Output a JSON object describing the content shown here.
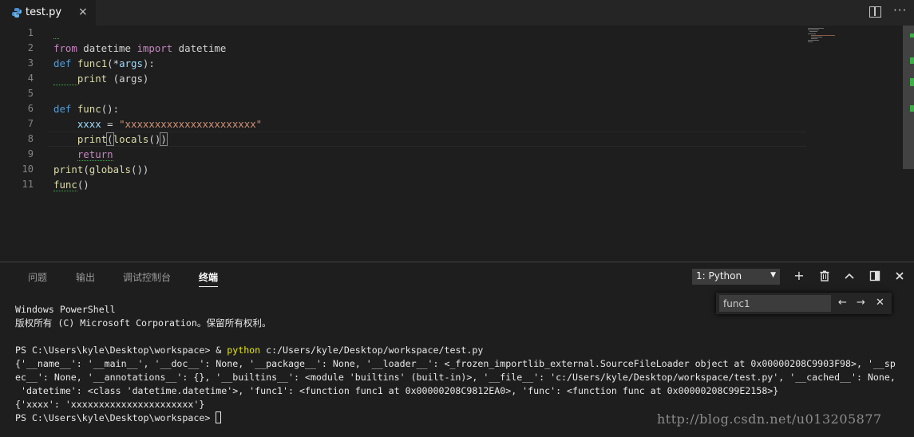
{
  "tab": {
    "filename": "test.py",
    "close": "×"
  },
  "editor_actions": {
    "more": "···"
  },
  "line_numbers": [
    "1",
    "2",
    "3",
    "4",
    "5",
    "6",
    "7",
    "8",
    "9",
    "10",
    "11"
  ],
  "code": {
    "l2": {
      "kw1": "from",
      "mod": " datetime ",
      "kw2": "import",
      "name": " datetime"
    },
    "l3": {
      "kw": "def",
      "fn": " func1",
      "open": "(*",
      "arg": "args",
      "close": "):"
    },
    "l4": {
      "fn": "print",
      "rest": " (args)"
    },
    "l6": {
      "kw": "def",
      "fn": " func",
      "rest": "():"
    },
    "l7": {
      "var": "xxxx",
      "eq": " = ",
      "str": "\"xxxxxxxxxxxxxxxxxxxxxx\""
    },
    "l8": {
      "fn": "print",
      "p1": "(",
      "fn2": "locals",
      "p2": "()",
      "p3": ")"
    },
    "l9": {
      "kw": "return"
    },
    "l10": {
      "fn": "print",
      "p1": "(",
      "fn2": "globals",
      "p2": "())"
    },
    "l11": {
      "fn": "func",
      "p": "()"
    }
  },
  "panel": {
    "tabs": [
      "问题",
      "输出",
      "调试控制台",
      "终端"
    ],
    "terminal_select": "1: Python",
    "find_value": "func1"
  },
  "terminal": {
    "line1": "Windows PowerShell",
    "line2": "版权所有 (C) Microsoft Corporation。保留所有权利。",
    "prompt1": "PS C:\\Users\\kyle\\Desktop\\workspace> & ",
    "cmd": "python",
    "cmd_arg": " c:/Users/kyle/Desktop/workspace/test.py",
    "out1": "{'__name__': '__main__', '__doc__': None, '__package__': None, '__loader__': <_frozen_importlib_external.SourceFileLoader object at 0x00000208C9903F98>, '__sp",
    "out2": "ec__': None, '__annotations__': {}, '__builtins__': <module 'builtins' (built-in)>, '__file__': 'c:/Users/kyle/Desktop/workspace/test.py', '__cached__': None,",
    "out3": " 'datetime': <class 'datetime.datetime'>, 'func1': <function func1 at 0x00000208C9812EA0>, 'func': <function func at 0x00000208C99E2158>}",
    "out4": "{'xxxx': 'xxxxxxxxxxxxxxxxxxxxxx'}",
    "prompt2": "PS C:\\Users\\kyle\\Desktop\\workspace> "
  },
  "watermark": "http://blog.csdn.net/u013205877",
  "colors": {
    "keyword": "#c586c0",
    "keyword_def": "#569cd6",
    "function": "#dcdcaa",
    "string": "#ce9178",
    "variable": "#9cdcfe",
    "background": "#1e1e1e"
  }
}
